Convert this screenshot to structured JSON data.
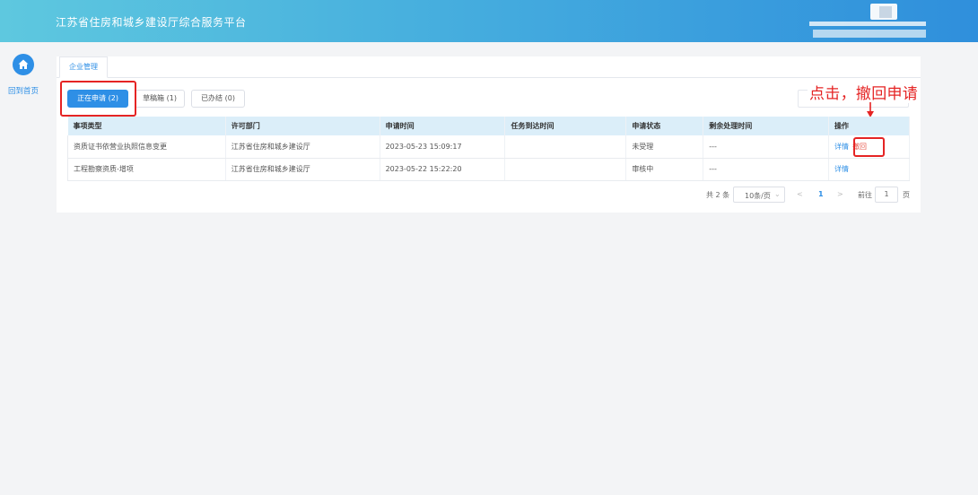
{
  "header": {
    "title": "江苏省住房和城乡建设厅综合服务平台"
  },
  "sidebar": {
    "home_label": "回到首页"
  },
  "tabs": {
    "active": "企业管理"
  },
  "sub_tabs": [
    {
      "label": "正在申请 (2)"
    },
    {
      "label": "草稿箱 (1)"
    },
    {
      "label": "已办结 (0)"
    }
  ],
  "annotation": {
    "text": "点击，撤回申请"
  },
  "table": {
    "headers": [
      "事项类型",
      "许可部门",
      "申请时间",
      "任务到达时间",
      "申请状态",
      "剩余处理时间",
      "操作"
    ],
    "rows": [
      {
        "type": "资质证书依营业执照信息变更",
        "dept": "江苏省住房和城乡建设厅",
        "time": "2023-05-23 15:09:17",
        "arrival": "",
        "status": "未受理",
        "remaining": "---",
        "actions": [
          "详情",
          "撤回"
        ]
      },
      {
        "type": "工程勘察资质-增项",
        "dept": "江苏省住房和城乡建设厅",
        "time": "2023-05-22 15:22:20",
        "arrival": "",
        "status": "审核中",
        "remaining": "---",
        "actions": [
          "详情"
        ]
      }
    ]
  },
  "pagination": {
    "total": "共 2 条",
    "page_size": "10条/页",
    "prev": "<",
    "current": "1",
    "next": ">",
    "goto_label": "前往",
    "goto_value": "1",
    "page_suffix": "页"
  },
  "colors": {
    "primary": "#2e8fe6",
    "highlight": "#e52424"
  }
}
